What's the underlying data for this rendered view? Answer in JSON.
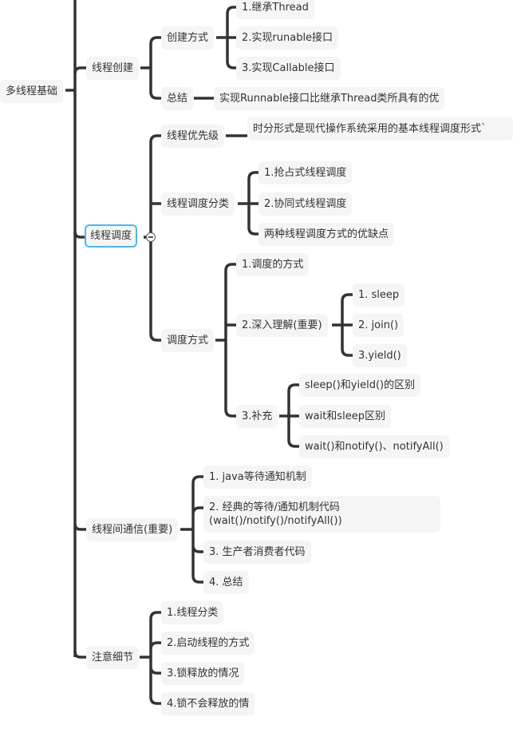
{
  "root": {
    "label": "多线程基础"
  },
  "branches": [
    {
      "label": "线程创建",
      "children": [
        {
          "label": "创建方式",
          "children": [
            {
              "label": "1.继承Thread"
            },
            {
              "label": "2.实现runable接口"
            },
            {
              "label": "3.实现Callable接口"
            }
          ]
        },
        {
          "label": "总结",
          "children": [
            {
              "label": "实现Runnable接口比继承Thread类所具有的优"
            }
          ]
        }
      ]
    },
    {
      "label": "线程调度",
      "selected": true,
      "collapse_icon": "minus-circle",
      "children": [
        {
          "label": "线程优先级",
          "children": [
            {
              "label": "时分形式是现代操作系统采用的基本线程调度形式`"
            }
          ]
        },
        {
          "label": "线程调度分类",
          "children": [
            {
              "label": "1.抢占式线程调度"
            },
            {
              "label": "2.协同式线程调度"
            },
            {
              "label": "两种线程调度方式的优缺点"
            }
          ]
        },
        {
          "label": "调度方式",
          "children": [
            {
              "label": "1.调度的方式"
            },
            {
              "label": "2.深入理解(重要)",
              "children": [
                {
                  "label": "1. sleep"
                },
                {
                  "label": "2. join()"
                },
                {
                  "label": "3.yield()"
                }
              ]
            },
            {
              "label": "3.补充",
              "children": [
                {
                  "label": "sleep()和yield()的区别"
                },
                {
                  "label": "wait和sleep区别"
                },
                {
                  "label": "wait()和notify()、notifyAll()"
                }
              ]
            }
          ]
        }
      ]
    },
    {
      "label": "线程间通信(重要)",
      "children": [
        {
          "label": "1. java等待通知机制"
        },
        {
          "label": "2. 经典的等待/通知机制代码(wait()/notify()/notifyAll())"
        },
        {
          "label": "3. 生产者消费者代码"
        },
        {
          "label": "4. 总结"
        }
      ]
    },
    {
      "label": "注意细节",
      "children": [
        {
          "label": "1.线程分类"
        },
        {
          "label": "2.启动线程的方式"
        },
        {
          "label": "3.锁释放的情况"
        },
        {
          "label": "4.锁不会释放的情"
        }
      ]
    }
  ],
  "colors": {
    "line": "#333333",
    "node_bg": "#f5f5f5",
    "selected_border": "#4db8ec",
    "text": "#333333"
  }
}
